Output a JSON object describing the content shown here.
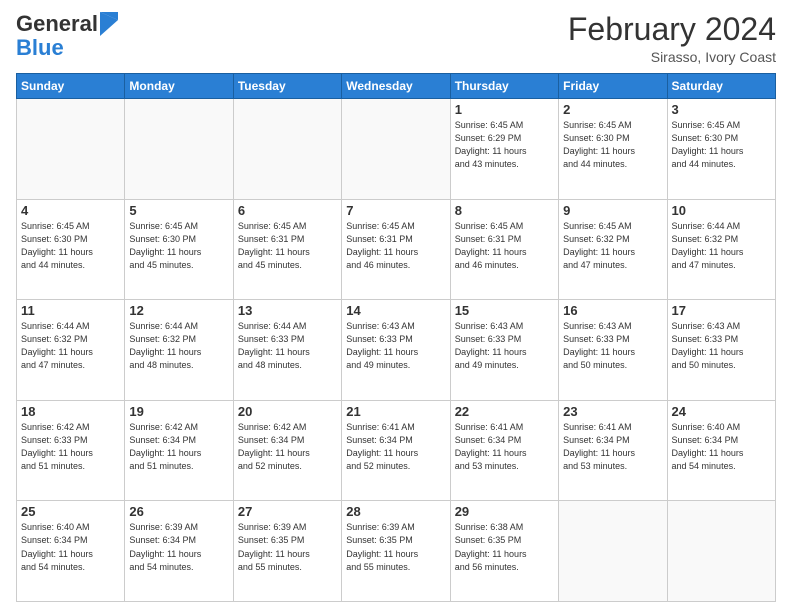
{
  "header": {
    "logo_line1": "General",
    "logo_line2": "Blue",
    "month_title": "February 2024",
    "location": "Sirasso, Ivory Coast"
  },
  "days_of_week": [
    "Sunday",
    "Monday",
    "Tuesday",
    "Wednesday",
    "Thursday",
    "Friday",
    "Saturday"
  ],
  "weeks": [
    [
      {
        "day": "",
        "info": ""
      },
      {
        "day": "",
        "info": ""
      },
      {
        "day": "",
        "info": ""
      },
      {
        "day": "",
        "info": ""
      },
      {
        "day": "1",
        "info": "Sunrise: 6:45 AM\nSunset: 6:29 PM\nDaylight: 11 hours\nand 43 minutes."
      },
      {
        "day": "2",
        "info": "Sunrise: 6:45 AM\nSunset: 6:30 PM\nDaylight: 11 hours\nand 44 minutes."
      },
      {
        "day": "3",
        "info": "Sunrise: 6:45 AM\nSunset: 6:30 PM\nDaylight: 11 hours\nand 44 minutes."
      }
    ],
    [
      {
        "day": "4",
        "info": "Sunrise: 6:45 AM\nSunset: 6:30 PM\nDaylight: 11 hours\nand 44 minutes."
      },
      {
        "day": "5",
        "info": "Sunrise: 6:45 AM\nSunset: 6:30 PM\nDaylight: 11 hours\nand 45 minutes."
      },
      {
        "day": "6",
        "info": "Sunrise: 6:45 AM\nSunset: 6:31 PM\nDaylight: 11 hours\nand 45 minutes."
      },
      {
        "day": "7",
        "info": "Sunrise: 6:45 AM\nSunset: 6:31 PM\nDaylight: 11 hours\nand 46 minutes."
      },
      {
        "day": "8",
        "info": "Sunrise: 6:45 AM\nSunset: 6:31 PM\nDaylight: 11 hours\nand 46 minutes."
      },
      {
        "day": "9",
        "info": "Sunrise: 6:45 AM\nSunset: 6:32 PM\nDaylight: 11 hours\nand 47 minutes."
      },
      {
        "day": "10",
        "info": "Sunrise: 6:44 AM\nSunset: 6:32 PM\nDaylight: 11 hours\nand 47 minutes."
      }
    ],
    [
      {
        "day": "11",
        "info": "Sunrise: 6:44 AM\nSunset: 6:32 PM\nDaylight: 11 hours\nand 47 minutes."
      },
      {
        "day": "12",
        "info": "Sunrise: 6:44 AM\nSunset: 6:32 PM\nDaylight: 11 hours\nand 48 minutes."
      },
      {
        "day": "13",
        "info": "Sunrise: 6:44 AM\nSunset: 6:33 PM\nDaylight: 11 hours\nand 48 minutes."
      },
      {
        "day": "14",
        "info": "Sunrise: 6:43 AM\nSunset: 6:33 PM\nDaylight: 11 hours\nand 49 minutes."
      },
      {
        "day": "15",
        "info": "Sunrise: 6:43 AM\nSunset: 6:33 PM\nDaylight: 11 hours\nand 49 minutes."
      },
      {
        "day": "16",
        "info": "Sunrise: 6:43 AM\nSunset: 6:33 PM\nDaylight: 11 hours\nand 50 minutes."
      },
      {
        "day": "17",
        "info": "Sunrise: 6:43 AM\nSunset: 6:33 PM\nDaylight: 11 hours\nand 50 minutes."
      }
    ],
    [
      {
        "day": "18",
        "info": "Sunrise: 6:42 AM\nSunset: 6:33 PM\nDaylight: 11 hours\nand 51 minutes."
      },
      {
        "day": "19",
        "info": "Sunrise: 6:42 AM\nSunset: 6:34 PM\nDaylight: 11 hours\nand 51 minutes."
      },
      {
        "day": "20",
        "info": "Sunrise: 6:42 AM\nSunset: 6:34 PM\nDaylight: 11 hours\nand 52 minutes."
      },
      {
        "day": "21",
        "info": "Sunrise: 6:41 AM\nSunset: 6:34 PM\nDaylight: 11 hours\nand 52 minutes."
      },
      {
        "day": "22",
        "info": "Sunrise: 6:41 AM\nSunset: 6:34 PM\nDaylight: 11 hours\nand 53 minutes."
      },
      {
        "day": "23",
        "info": "Sunrise: 6:41 AM\nSunset: 6:34 PM\nDaylight: 11 hours\nand 53 minutes."
      },
      {
        "day": "24",
        "info": "Sunrise: 6:40 AM\nSunset: 6:34 PM\nDaylight: 11 hours\nand 54 minutes."
      }
    ],
    [
      {
        "day": "25",
        "info": "Sunrise: 6:40 AM\nSunset: 6:34 PM\nDaylight: 11 hours\nand 54 minutes."
      },
      {
        "day": "26",
        "info": "Sunrise: 6:39 AM\nSunset: 6:34 PM\nDaylight: 11 hours\nand 54 minutes."
      },
      {
        "day": "27",
        "info": "Sunrise: 6:39 AM\nSunset: 6:35 PM\nDaylight: 11 hours\nand 55 minutes."
      },
      {
        "day": "28",
        "info": "Sunrise: 6:39 AM\nSunset: 6:35 PM\nDaylight: 11 hours\nand 55 minutes."
      },
      {
        "day": "29",
        "info": "Sunrise: 6:38 AM\nSunset: 6:35 PM\nDaylight: 11 hours\nand 56 minutes."
      },
      {
        "day": "",
        "info": ""
      },
      {
        "day": "",
        "info": ""
      }
    ]
  ]
}
